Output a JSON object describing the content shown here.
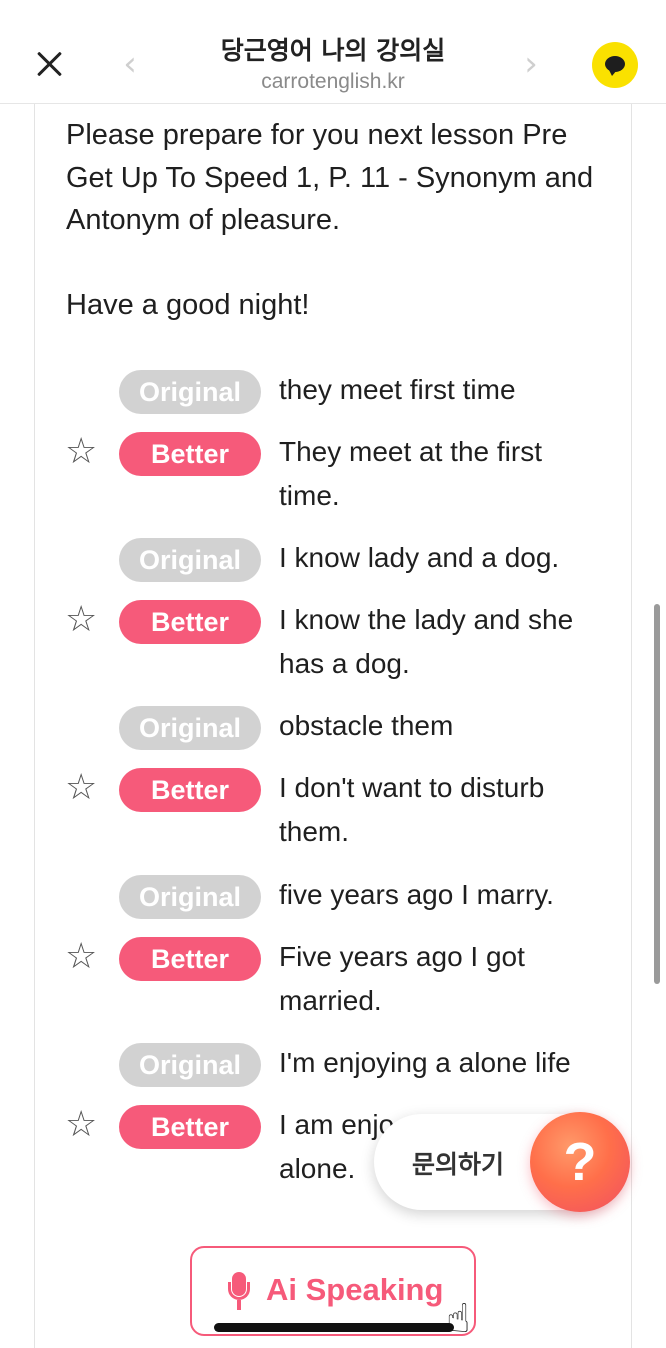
{
  "header": {
    "title": "당근영어 나의 강의실",
    "subtitle": "carrotenglish.kr",
    "back_glyph": "‹",
    "forward_glyph": "›"
  },
  "message": "Please prepare for you next lesson Pre Get Up To Speed 1, P. 11 - Synonym and Antonym of pleasure.\n\nHave a good night!",
  "corrections": [
    {
      "original_label": "Original",
      "better_label": "Better",
      "original": "they meet first time",
      "better": "They meet at the first time."
    },
    {
      "original_label": "Original",
      "better_label": "Better",
      "original": "I know lady  and a dog.",
      "better": "I know  the lady and she has a dog."
    },
    {
      "original_label": "Original",
      "better_label": "Better",
      "original": "obstacle them",
      "better": "I don't  want to disturb them."
    },
    {
      "original_label": "Original",
      "better_label": "Better",
      "original": "five years ago I marry.",
      "better": "Five years ago I got married."
    },
    {
      "original_label": "Original",
      "better_label": "Better",
      "original": "I'm enjoying  a alone life",
      "better": "I am enjo\nalone."
    }
  ],
  "star_glyph": "☆",
  "help": {
    "label": "문의하기",
    "glyph": "?"
  },
  "ai_button": {
    "label": "Ai Speaking"
  },
  "colors": {
    "accent": "#f65a7a",
    "original_pill": "#d2d2d2",
    "kakao": "#fae100",
    "help_orange": "#ff6f4a"
  },
  "icons": [
    "close-icon",
    "chevron-left-icon",
    "chevron-right-icon",
    "kakao-chat-icon",
    "star-icon",
    "microphone-icon",
    "hand-pointer-icon",
    "question-icon"
  ]
}
